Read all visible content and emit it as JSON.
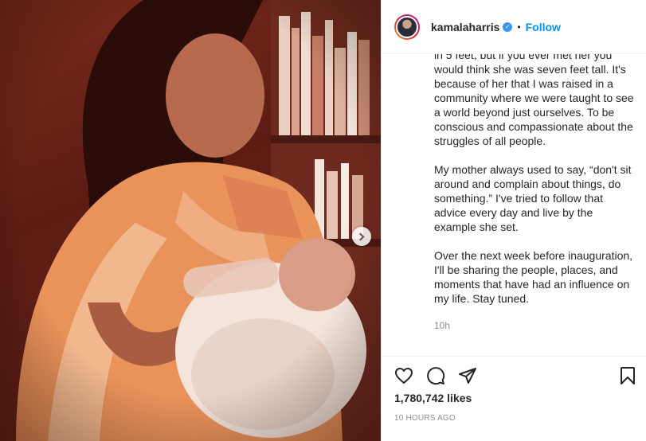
{
  "header": {
    "username": "kamalaharris",
    "separator": "•",
    "follow_label": "Follow"
  },
  "caption": {
    "paragraphs": [
      "in 5 feet, but if you ever met her you would think she was seven feet tall. It's because of her that I was raised in a community where we were taught to see a world beyond just ourselves. To be conscious and compassionate about the struggles of all people.",
      "My mother always used to say, “don't sit around and complain about things, do something.” I've tried to follow that advice every day and live by the example she set.",
      "Over the next week before inauguration, I'll be sharing the people, places, and moments that have had an influence on my life. Stay tuned."
    ],
    "time_short": "10h"
  },
  "footer": {
    "likes": "1,780,742 likes",
    "time_ago": "10 HOURS AGO"
  },
  "icons": {
    "like": "heart-icon",
    "comment": "comment-icon",
    "share": "paper-plane-icon",
    "save": "bookmark-icon",
    "verified": "verified-badge-icon",
    "next": "chevron-right-icon"
  },
  "colors": {
    "follow": "#0095f6",
    "verified": "#3897f0",
    "muted": "#8e8e8e"
  }
}
